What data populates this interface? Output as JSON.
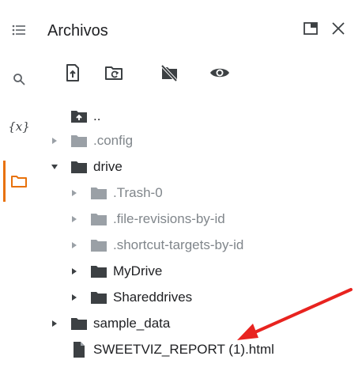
{
  "panel": {
    "title": "Archivos"
  },
  "rail": {
    "items": [
      {
        "icon": "menu-icon"
      },
      {
        "icon": "search-icon"
      },
      {
        "icon": "variables-icon",
        "label": "{x}"
      },
      {
        "icon": "folder-icon",
        "active": true
      }
    ],
    "active_color": "#e8710a"
  },
  "toolbar": {
    "items": [
      {
        "icon": "upload-file-icon"
      },
      {
        "icon": "refresh-folder-icon"
      },
      {
        "icon": "unmount-drive-icon"
      },
      {
        "icon": "show-hidden-files-icon"
      }
    ]
  },
  "tree": [
    {
      "name": "..",
      "type": "parent",
      "level": 0,
      "muted": false
    },
    {
      "name": ".config",
      "type": "folder",
      "level": 0,
      "expanded": false,
      "muted": true
    },
    {
      "name": "drive",
      "type": "folder",
      "level": 0,
      "expanded": true,
      "muted": false
    },
    {
      "name": ".Trash-0",
      "type": "folder",
      "level": 1,
      "expanded": false,
      "muted": true
    },
    {
      "name": ".file-revisions-by-id",
      "type": "folder",
      "level": 1,
      "expanded": false,
      "muted": true
    },
    {
      "name": ".shortcut-targets-by-id",
      "type": "folder",
      "level": 1,
      "expanded": false,
      "muted": true
    },
    {
      "name": "MyDrive",
      "type": "folder",
      "level": 1,
      "expanded": false,
      "muted": false
    },
    {
      "name": "Shareddrives",
      "type": "folder",
      "level": 1,
      "expanded": false,
      "muted": false
    },
    {
      "name": "sample_data",
      "type": "folder",
      "level": 0,
      "expanded": false,
      "muted": false
    },
    {
      "name": "SWEETVIZ_REPORT (1).html",
      "type": "file",
      "level": 0,
      "muted": false
    }
  ],
  "annotation": {
    "arrow_color": "#e8231f",
    "points_to": "SWEETVIZ_REPORT (1).html"
  }
}
